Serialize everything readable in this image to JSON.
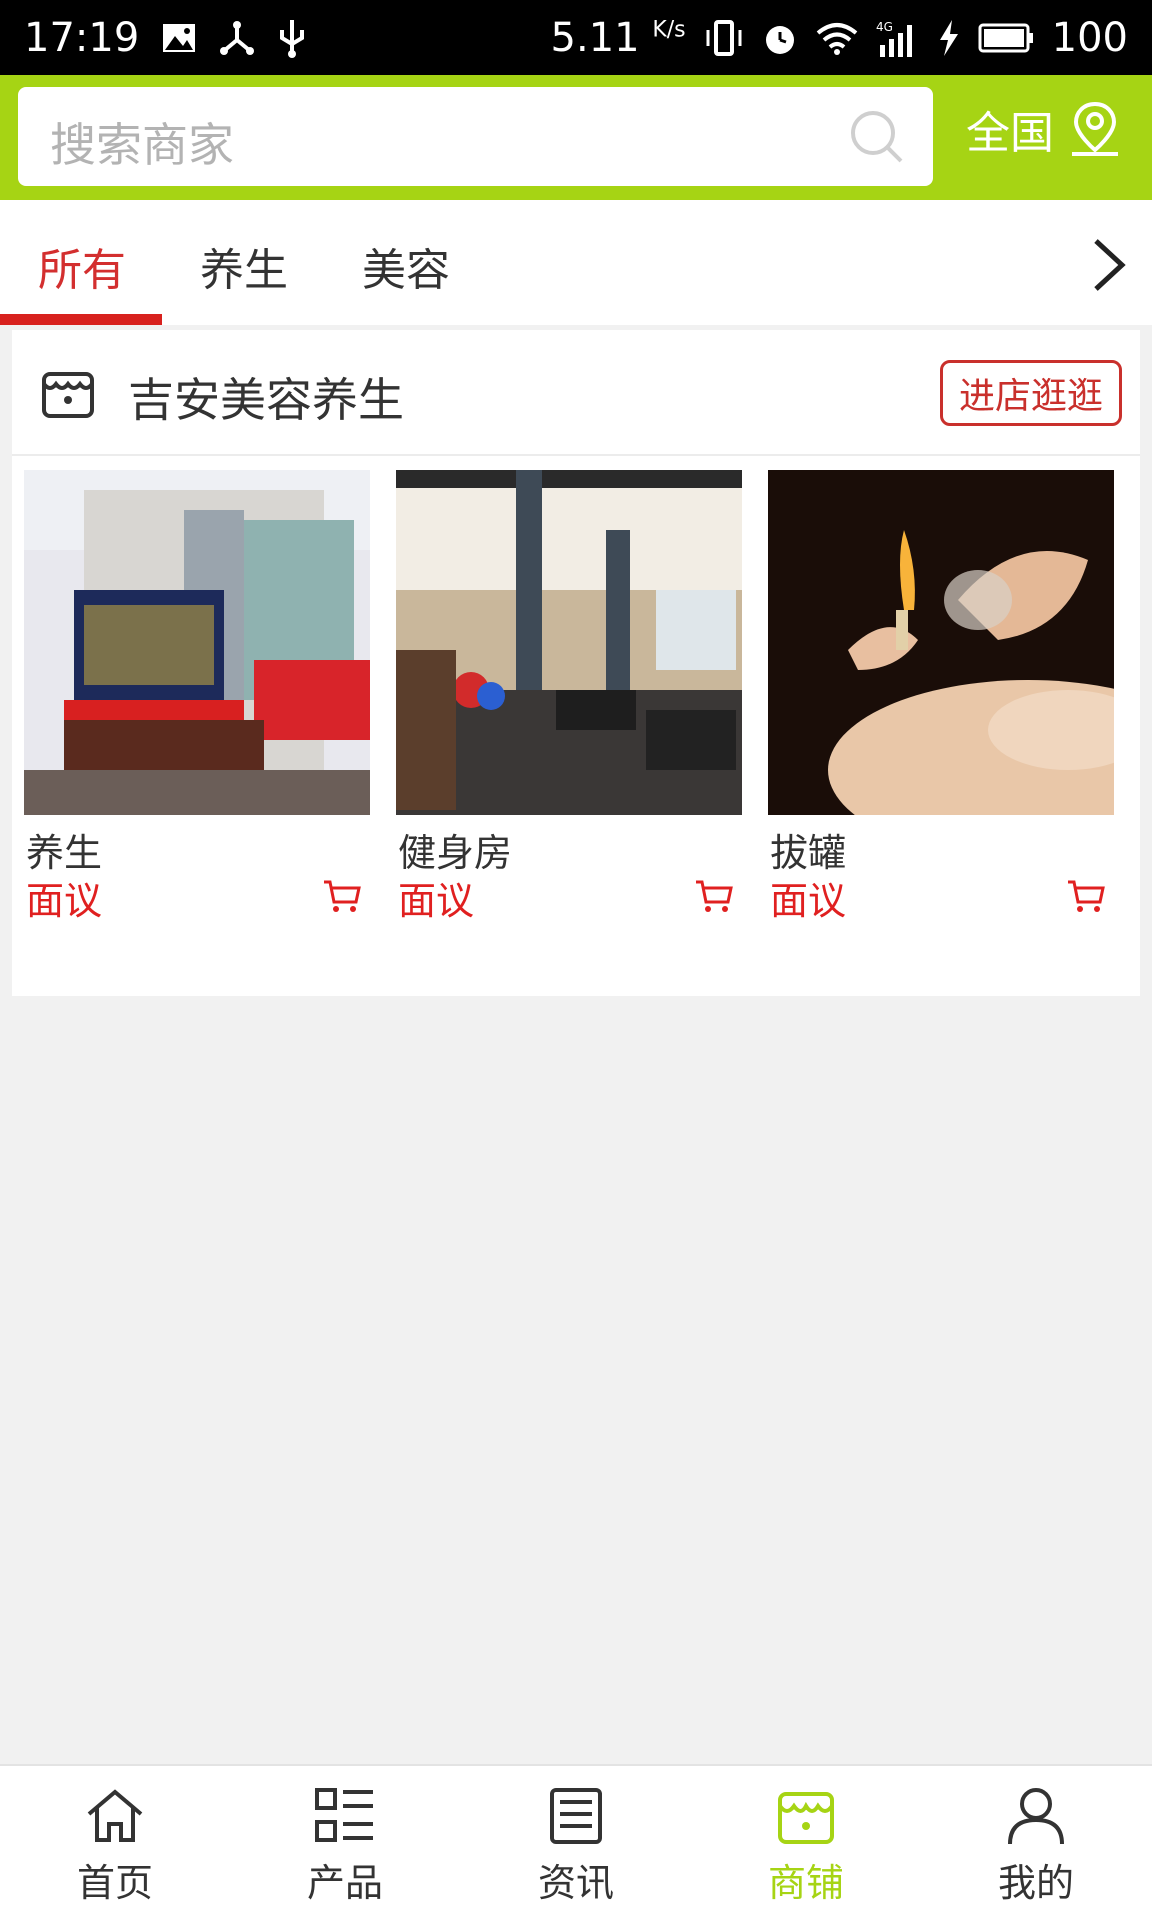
{
  "status_bar": {
    "time": "17:19",
    "speed": "5.11",
    "speed_unit": "K/s",
    "network": "4G",
    "battery": "100"
  },
  "header": {
    "search_placeholder": "搜索商家",
    "region": "全国"
  },
  "tabs": [
    {
      "label": "所有",
      "active": true
    },
    {
      "label": "养生",
      "active": false
    },
    {
      "label": "美容",
      "active": false
    }
  ],
  "shop": {
    "name": "吉安美容养生",
    "enter_label": "进店逛逛"
  },
  "products": [
    {
      "name": "养生",
      "price": "面议",
      "image": "storefront-building"
    },
    {
      "name": "健身房",
      "price": "面议",
      "image": "gym-interior"
    },
    {
      "name": "拔罐",
      "price": "面议",
      "image": "cupping-therapy"
    }
  ],
  "bottom_nav": [
    {
      "label": "首页",
      "icon": "home-icon",
      "active": false
    },
    {
      "label": "产品",
      "icon": "product-list-icon",
      "active": false
    },
    {
      "label": "资讯",
      "icon": "news-icon",
      "active": false
    },
    {
      "label": "商铺",
      "icon": "store-icon",
      "active": true
    },
    {
      "label": "我的",
      "icon": "user-icon",
      "active": false
    }
  ],
  "colors": {
    "brand_green": "#a6d414",
    "accent_red": "#d8211e"
  }
}
